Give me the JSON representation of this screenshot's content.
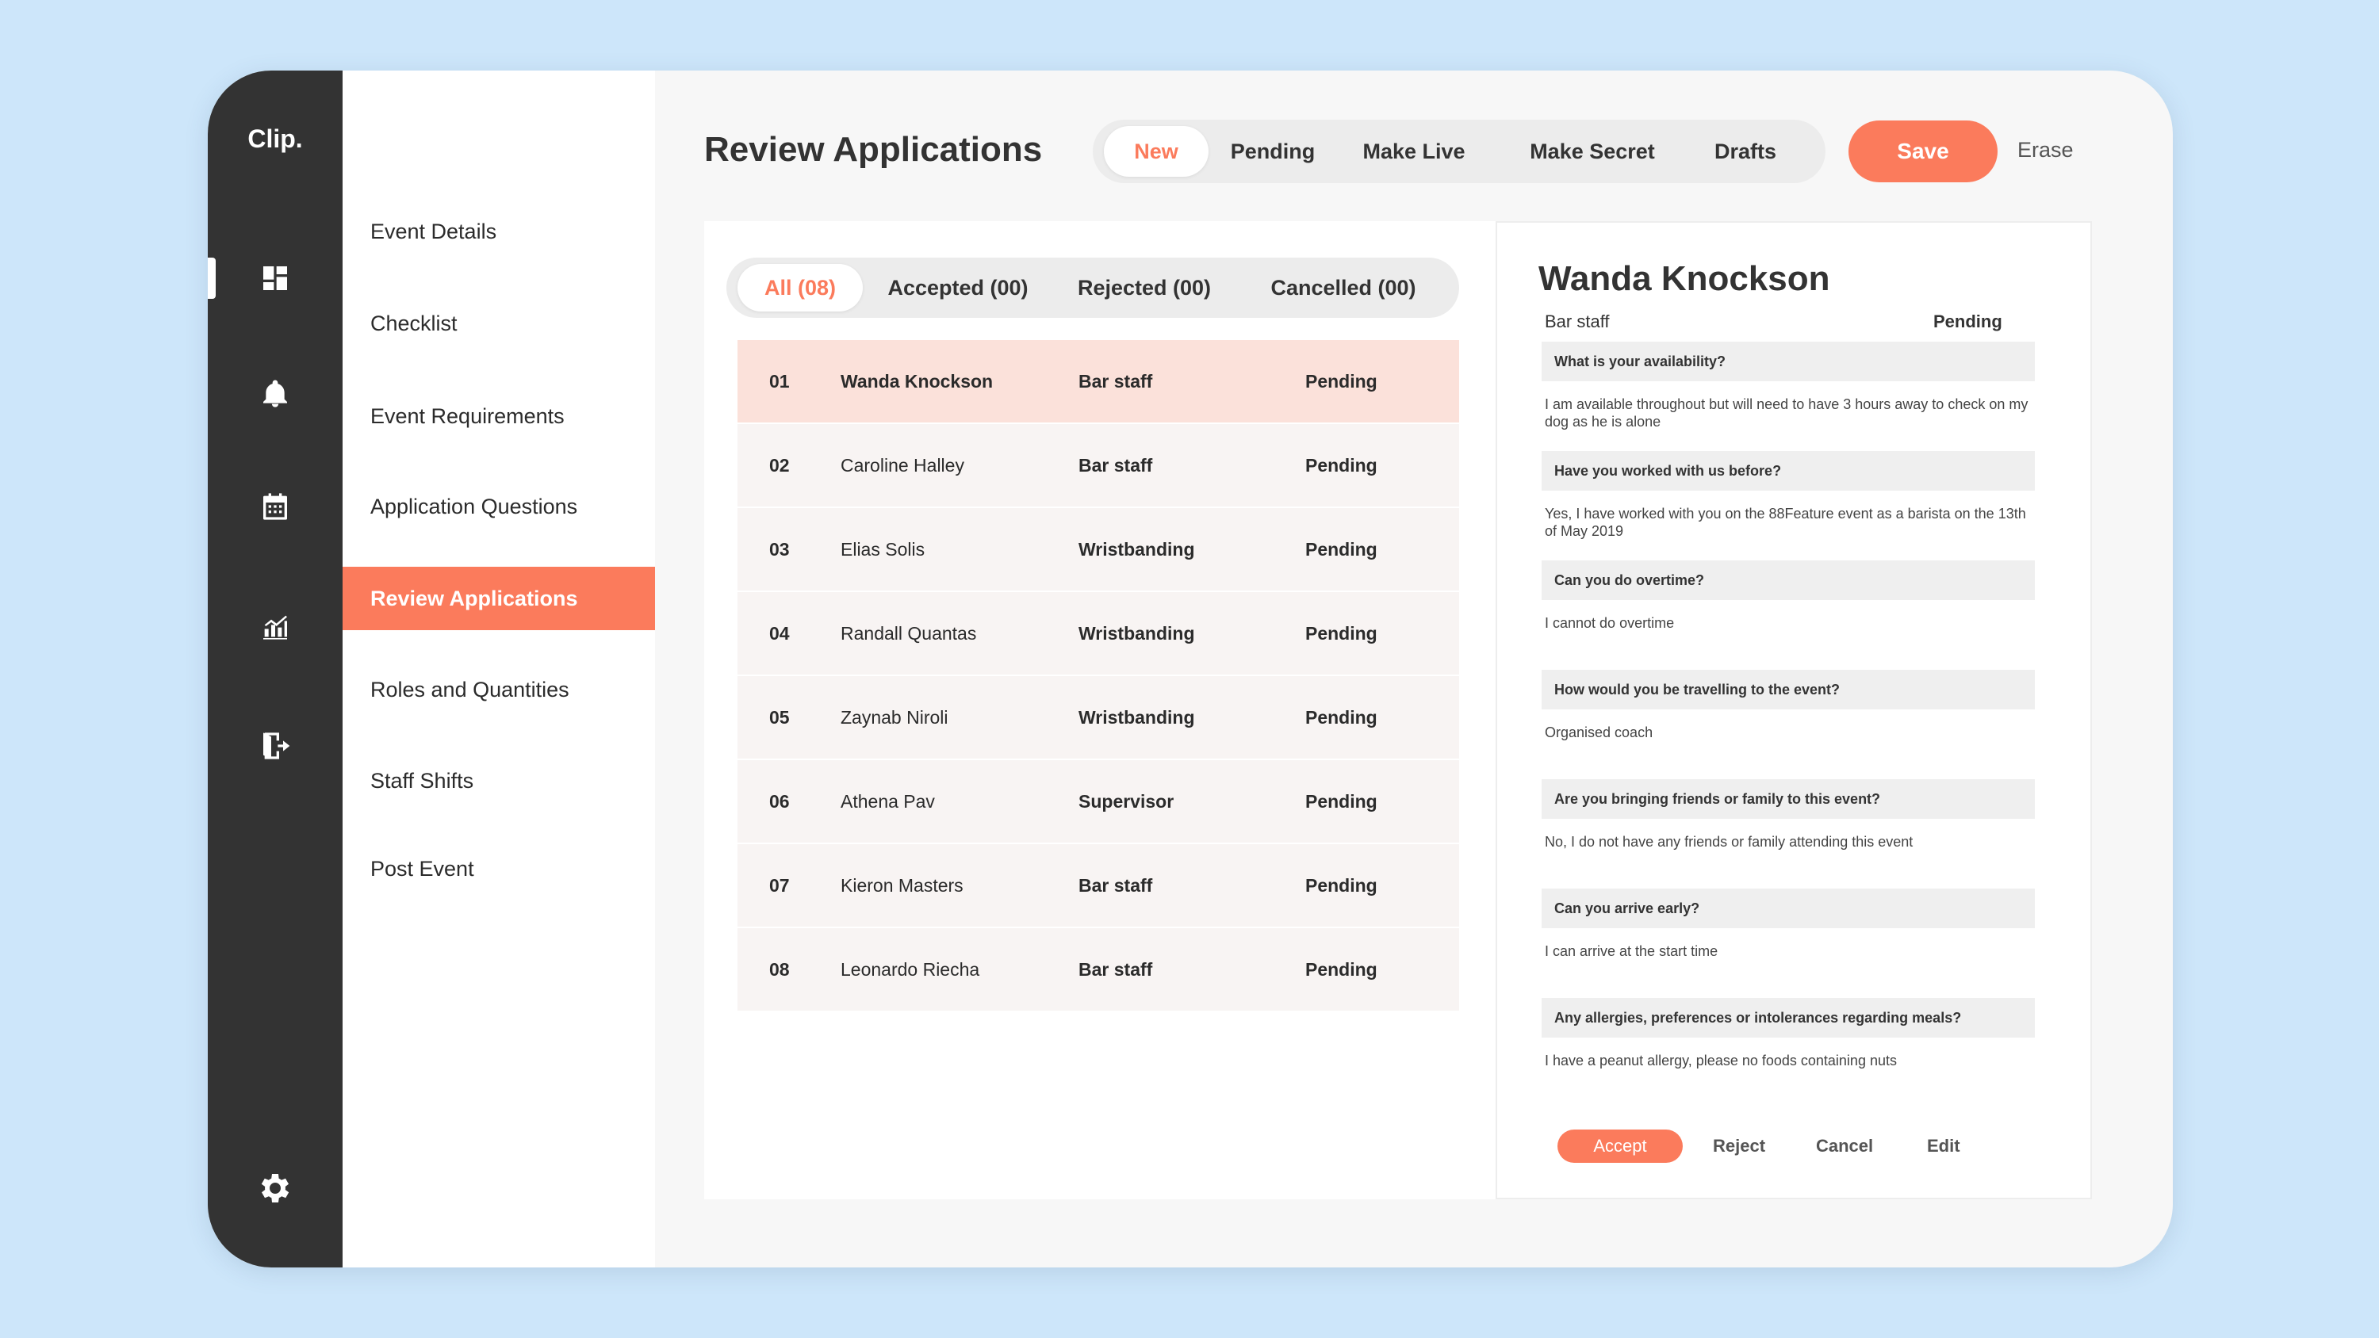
{
  "app": {
    "logo": "Clip."
  },
  "rail": {
    "icons": [
      "dashboard-icon",
      "bell-icon",
      "calendar-icon",
      "chart-icon",
      "export-icon",
      "gear-icon"
    ]
  },
  "subnav": {
    "items": [
      {
        "label": "Event Details"
      },
      {
        "label": "Checklist"
      },
      {
        "label": "Event Requirements"
      },
      {
        "label": "Application Questions"
      },
      {
        "label": "Review Applications"
      },
      {
        "label": "Roles and Quantities"
      },
      {
        "label": "Staff Shifts"
      },
      {
        "label": "Post Event"
      }
    ],
    "active": "Review Applications"
  },
  "header": {
    "title": "Review Applications",
    "status_tabs": [
      "New",
      "Pending",
      "Make Live",
      "Make Secret",
      "Drafts"
    ],
    "active_status_tab": "New",
    "save_label": "Save",
    "erase_label": "Erase"
  },
  "filters": {
    "tabs": [
      "All (08)",
      "Accepted (00)",
      "Rejected (00)",
      "Cancelled (00)"
    ],
    "active": "All (08)"
  },
  "applicants": [
    {
      "num": "01",
      "name": "Wanda Knockson",
      "role": "Bar staff",
      "status": "Pending"
    },
    {
      "num": "02",
      "name": "Caroline Halley",
      "role": "Bar staff",
      "status": "Pending"
    },
    {
      "num": "03",
      "name": "Elias Solis",
      "role": "Wristbanding",
      "status": "Pending"
    },
    {
      "num": "04",
      "name": "Randall Quantas",
      "role": "Wristbanding",
      "status": "Pending"
    },
    {
      "num": "05",
      "name": "Zaynab Niroli",
      "role": "Wristbanding",
      "status": "Pending"
    },
    {
      "num": "06",
      "name": "Athena Pav",
      "role": "Supervisor",
      "status": "Pending"
    },
    {
      "num": "07",
      "name": "Kieron Masters",
      "role": "Bar staff",
      "status": "Pending"
    },
    {
      "num": "08",
      "name": "Leonardo Riecha",
      "role": "Bar staff",
      "status": "Pending"
    }
  ],
  "detail": {
    "name": "Wanda Knockson",
    "role": "Bar staff",
    "status": "Pending",
    "qa": [
      {
        "q": "What is your availability?",
        "a": "I am available throughout but will need to have 3 hours away to check on my dog as he is alone"
      },
      {
        "q": "Have you worked with us before?",
        "a": "Yes, I have worked with you on the 88Feature event as a barista on the 13th of May 2019"
      },
      {
        "q": "Can you do overtime?",
        "a": "I cannot do overtime"
      },
      {
        "q": "How would you be travelling to the event?",
        "a": "Organised coach"
      },
      {
        "q": "Are you bringing friends or family to this event?",
        "a": "No, I do not have any friends or family attending this event"
      },
      {
        "q": "Can you arrive early?",
        "a": "I can arrive at the start time"
      },
      {
        "q": "Any allergies, preferences or intolerances regarding meals?",
        "a": "I have a peanut allergy, please no foods containing nuts"
      }
    ],
    "actions": {
      "accept": "Accept",
      "reject": "Reject",
      "cancel": "Cancel",
      "edit": "Edit"
    }
  },
  "colors": {
    "accent": "#fb7b5c",
    "rail": "#333333",
    "background": "#cde6fa"
  }
}
